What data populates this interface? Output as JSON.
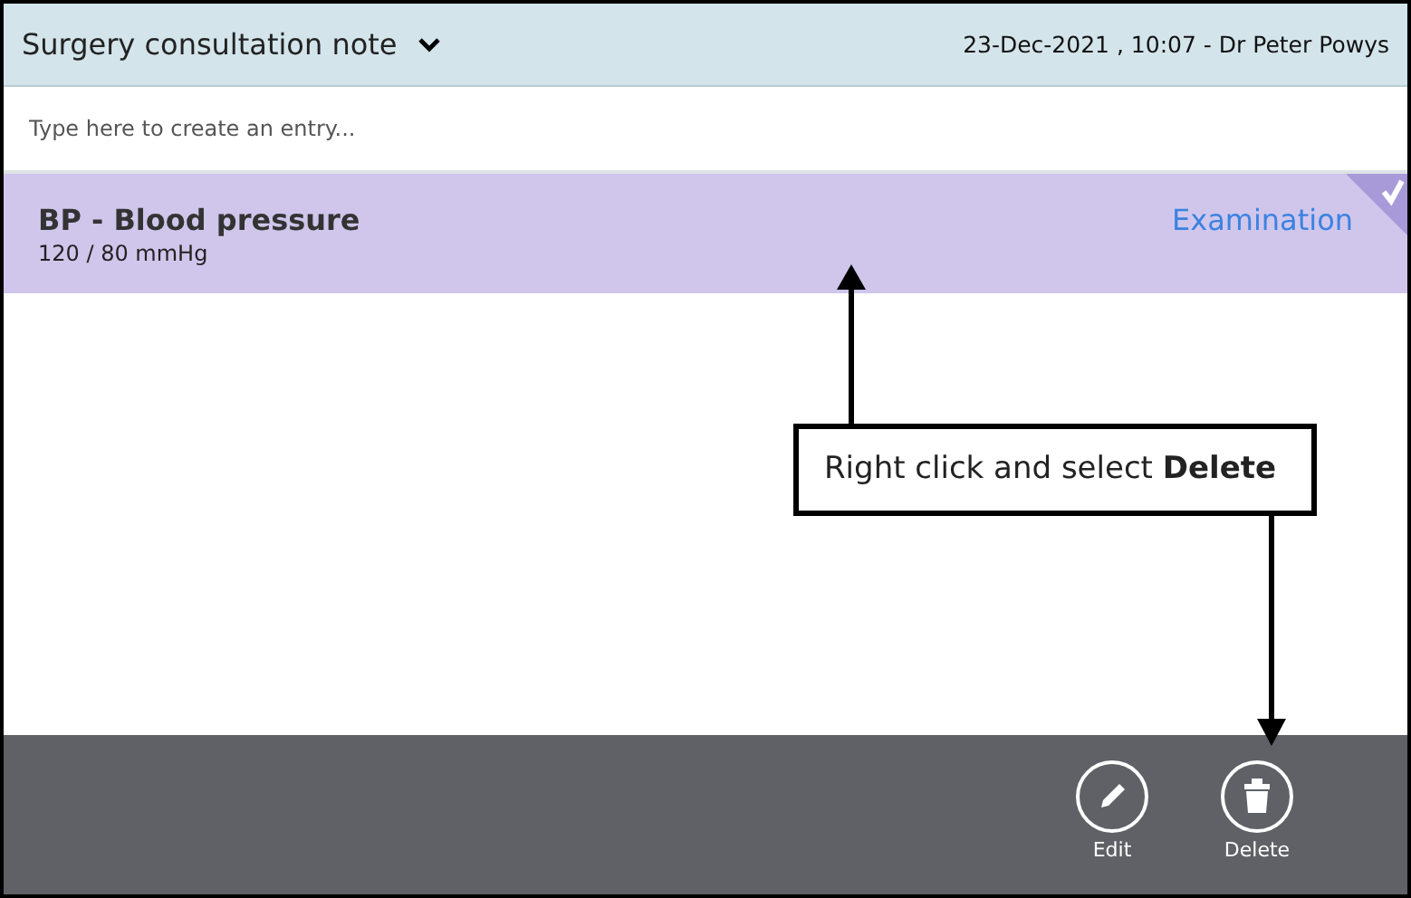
{
  "header": {
    "title": "Surgery consultation note",
    "meta": "23-Dec-2021 , 10:07 - Dr Peter Powys"
  },
  "entry_field": {
    "placeholder": "Type here to create an entry..."
  },
  "entries": [
    {
      "title": "BP - Blood pressure",
      "value": "120 / 80 mmHg",
      "category": "Examination",
      "selected": true
    }
  ],
  "callout": {
    "text": "Right click and select **Delete**"
  },
  "actions": [
    {
      "kind": "edit",
      "label": "Edit"
    },
    {
      "kind": "delete",
      "label": "Delete"
    }
  ]
}
